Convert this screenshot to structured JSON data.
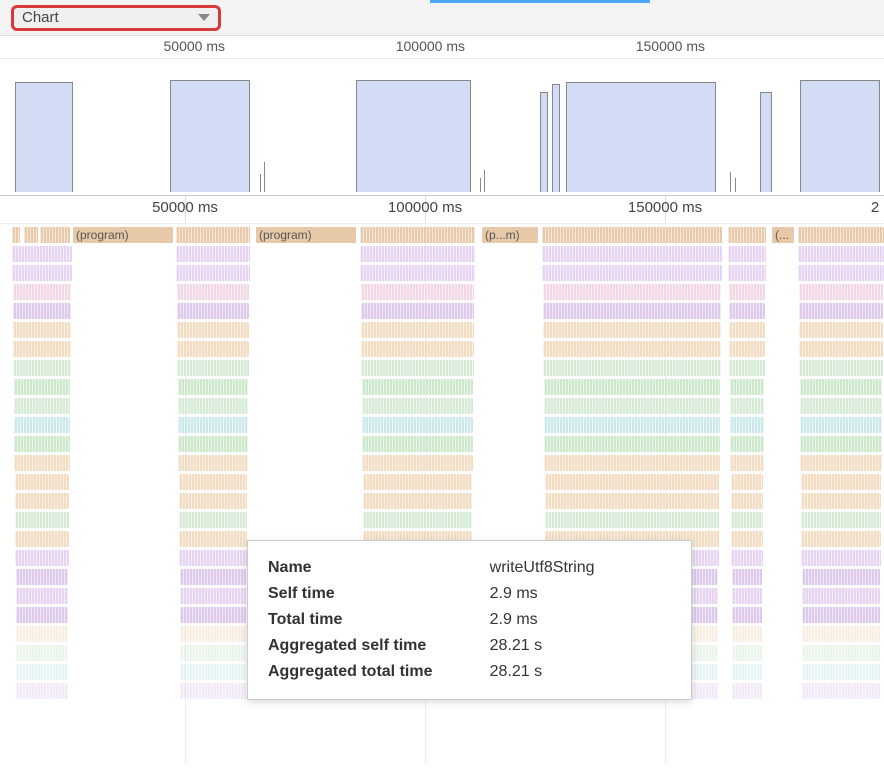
{
  "toolbar": {
    "view_mode": "Chart"
  },
  "overview": {
    "ticks": [
      "50000 ms",
      "100000 ms",
      "150000 ms"
    ]
  },
  "timeline": {
    "ticks": [
      "50000 ms",
      "100000 ms",
      "150000 ms"
    ]
  },
  "flame": {
    "top_labels": [
      "(program)",
      "(program)",
      "(p...m)",
      "(..."
    ]
  },
  "tooltip": {
    "rows": [
      {
        "label": "Name",
        "value": "writeUtf8String"
      },
      {
        "label": "Self time",
        "value": "2.9 ms"
      },
      {
        "label": "Total time",
        "value": "2.9 ms"
      },
      {
        "label": "Aggregated self time",
        "value": "28.21 s"
      },
      {
        "label": "Aggregated total time",
        "value": "28.21 s"
      }
    ]
  }
}
